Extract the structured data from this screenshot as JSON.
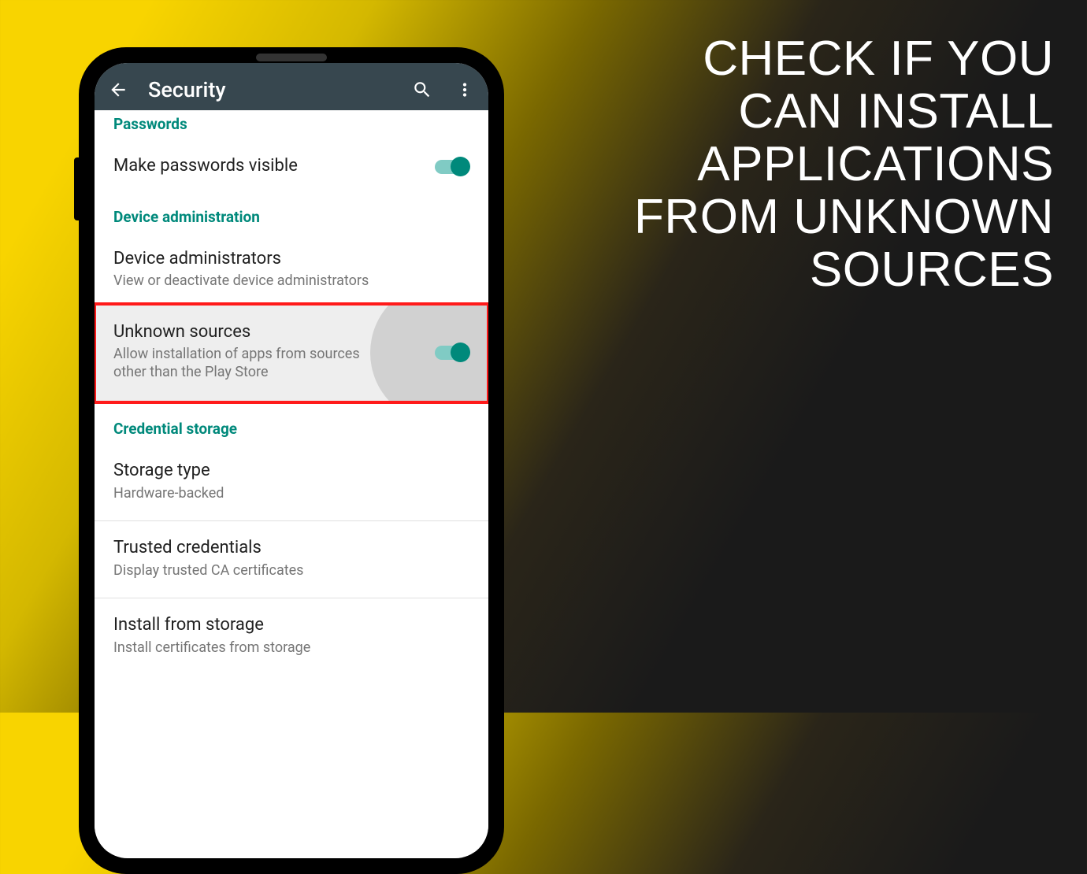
{
  "headline": {
    "l1": "CHECK IF YOU",
    "l2": "CAN INSTALL",
    "l3": "APPLICATIONS",
    "l4": "FROM UNKNOWN",
    "l5": "SOURCES"
  },
  "appbar": {
    "title": "Security"
  },
  "sections": {
    "passwords": {
      "header": "Passwords",
      "make_visible": "Make passwords visible"
    },
    "device_admin": {
      "header": "Device administration",
      "administrators_title": "Device administrators",
      "administrators_sub": "View or deactivate device administrators",
      "unknown_title": "Unknown sources",
      "unknown_sub": "Allow installation of apps from sources other than the Play Store"
    },
    "credential": {
      "header": "Credential storage",
      "storage_type_title": "Storage type",
      "storage_type_sub": "Hardware-backed",
      "trusted_title": "Trusted credentials",
      "trusted_sub": "Display trusted CA certificates",
      "install_title": "Install from storage",
      "install_sub": "Install certificates from storage"
    }
  },
  "colors": {
    "teal": "#00897b",
    "appbar": "#37474f",
    "highlight": "#ff1a1a"
  }
}
